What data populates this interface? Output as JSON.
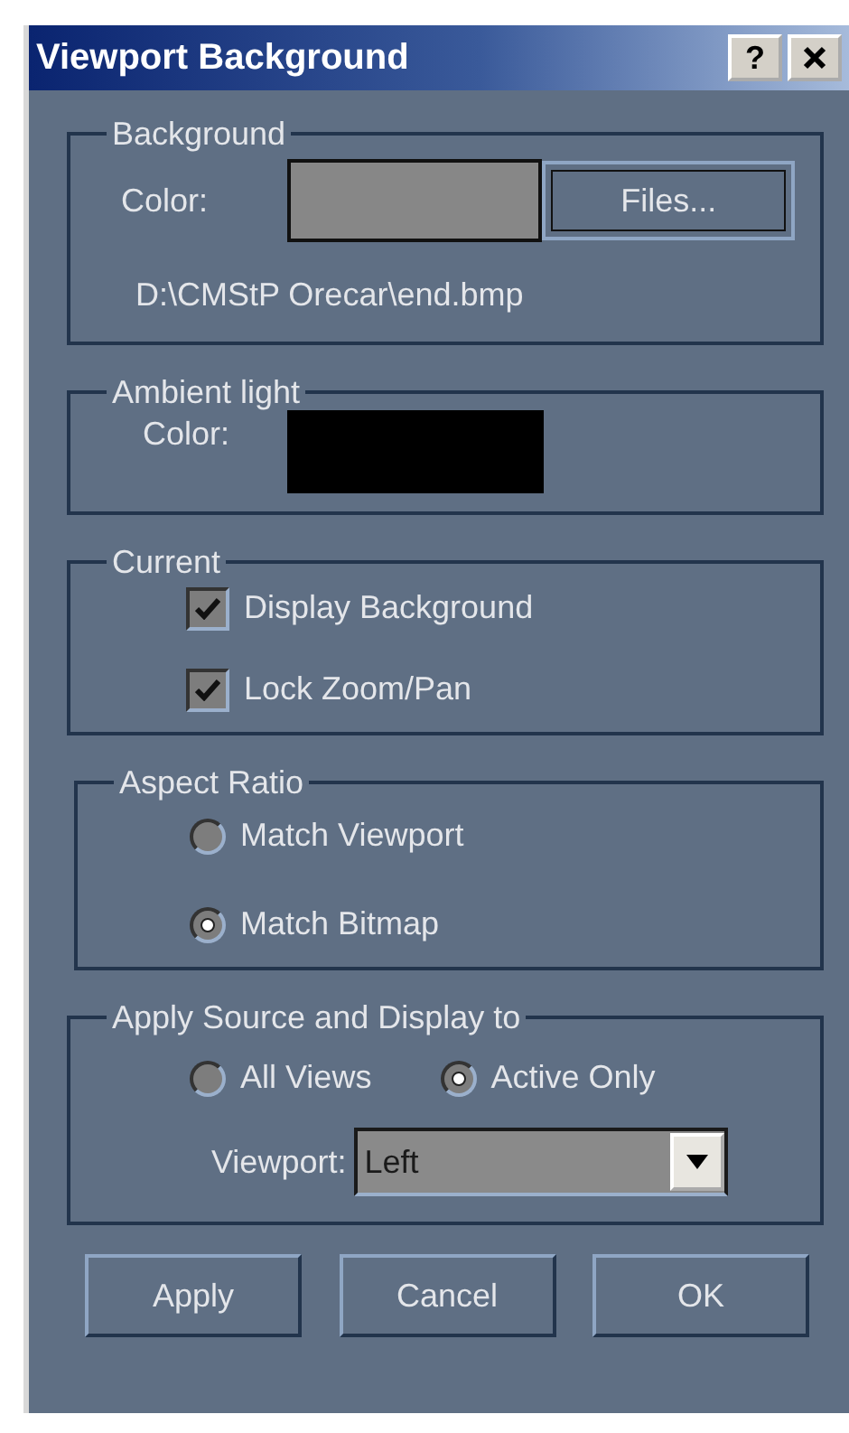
{
  "window": {
    "title": "Viewport Background",
    "help_button": "?"
  },
  "background": {
    "label": "Background",
    "color_label": "Color:",
    "color": "#878787",
    "files_button": "Files...",
    "path": "D:\\CMStP Orecar\\end.bmp"
  },
  "ambient_light": {
    "label": "Ambient light",
    "color_label": "Color:",
    "color": "#000000"
  },
  "current": {
    "label": "Current",
    "checkboxes": [
      {
        "label": "Display Background",
        "checked": true
      },
      {
        "label": "Lock Zoom/Pan",
        "checked": true
      }
    ]
  },
  "aspect_ratio": {
    "label": "Aspect Ratio",
    "radios": [
      {
        "label": "Match Viewport",
        "selected": false
      },
      {
        "label": "Match Bitmap",
        "selected": true
      }
    ]
  },
  "apply_to": {
    "label": "Apply Source and Display to",
    "radios": [
      {
        "label": "All Views",
        "selected": false
      },
      {
        "label": "Active Only",
        "selected": true
      }
    ],
    "viewport": {
      "label": "Viewport:",
      "value": "Left"
    }
  },
  "buttons": [
    "Apply",
    "Cancel",
    "OK"
  ]
}
